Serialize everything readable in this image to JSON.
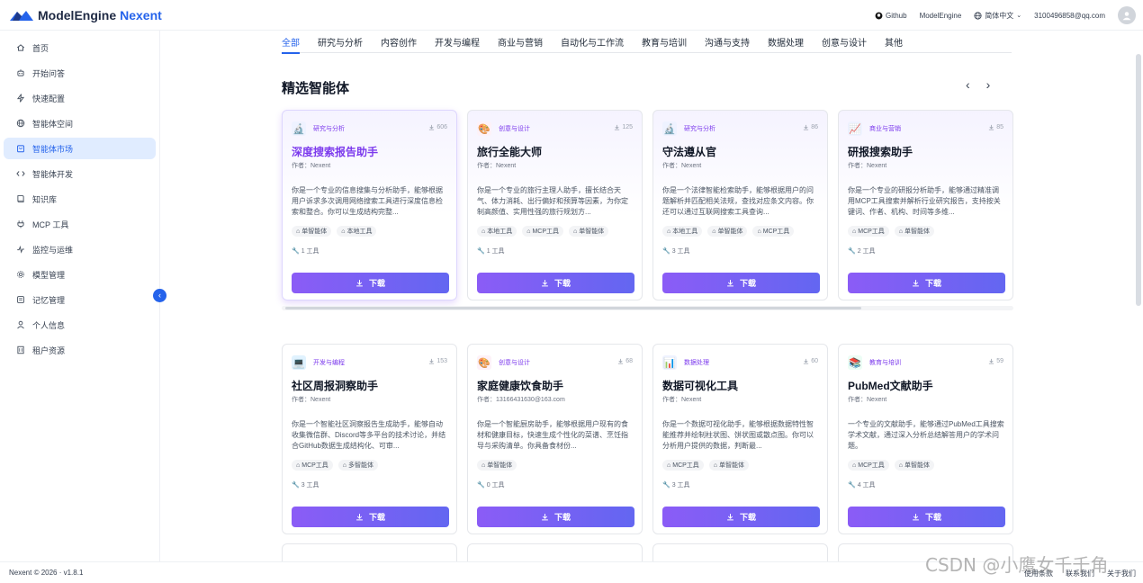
{
  "header": {
    "brand": "ModelEngine",
    "brand_accent": "Nexent",
    "github_label": "Github",
    "modelengine_label": "ModelEngine",
    "language_label": "简体中文",
    "user_email": "3100496858@qq.com"
  },
  "sidebar": {
    "items": [
      {
        "label": "首页",
        "icon": "home-icon"
      },
      {
        "label": "开始问答",
        "icon": "bot-icon"
      },
      {
        "label": "快速配置",
        "icon": "bolt-icon"
      },
      {
        "label": "智能体空间",
        "icon": "globe-icon"
      },
      {
        "label": "智能体市场",
        "icon": "store-icon",
        "active": true
      },
      {
        "label": "智能体开发",
        "icon": "code-icon"
      },
      {
        "label": "知识库",
        "icon": "book-icon"
      },
      {
        "label": "MCP 工具",
        "icon": "plug-icon"
      },
      {
        "label": "监控与运维",
        "icon": "monitor-icon"
      },
      {
        "label": "模型管理",
        "icon": "gear-icon"
      },
      {
        "label": "记忆管理",
        "icon": "memory-icon"
      },
      {
        "label": "个人信息",
        "icon": "user-icon"
      },
      {
        "label": "租户资源",
        "icon": "building-icon"
      }
    ]
  },
  "tabs": [
    "全部",
    "研究与分析",
    "内容创作",
    "开发与编程",
    "商业与营销",
    "自动化与工作流",
    "教育与培训",
    "沟通与支持",
    "数据处理",
    "创意与设计",
    "其他"
  ],
  "featured": {
    "title": "精选智能体",
    "prev_icon": "‹",
    "next_icon": "›"
  },
  "download_label": "下载",
  "featured_cards": [
    {
      "category": "研究与分析",
      "downloads": "606",
      "title": "深度搜索报告助手",
      "author": "作者：Nexent",
      "desc": "你是一个专业的信息搜集与分析助手，能够根据用户诉求多次调用网络搜索工具进行深度信息检索和整合。你可以生成结构完整...",
      "tags": [
        "单智能体",
        "本地工具"
      ],
      "tools": "1 工具",
      "icon": "🔬",
      "icon_bg": "#eef2ff"
    },
    {
      "category": "创意与设计",
      "downloads": "125",
      "title": "旅行全能大师",
      "author": "作者：Nexent",
      "desc": "你是一个专业的旅行主理人助手，擅长结合天气、体力消耗、出行偏好和预算等因素，为你定制高颜值、实用性强的旅行规划方...",
      "tags": [
        "本地工具",
        "MCP工具",
        "单智能体"
      ],
      "tools": "1 工具",
      "icon": "🎨",
      "icon_bg": "#fdf2f8"
    },
    {
      "category": "研究与分析",
      "downloads": "86",
      "title": "守法遵从官",
      "author": "作者：Nexent",
      "desc": "你是一个法律智能检索助手，能够根据用户的问题解析并匹配相关法规，查找对应条文内容。你还可以通过互联网搜索工具查询...",
      "tags": [
        "本地工具",
        "单智能体",
        "MCP工具"
      ],
      "tools": "3 工具",
      "icon": "🔬",
      "icon_bg": "#eef2ff"
    },
    {
      "category": "商业与营销",
      "downloads": "85",
      "title": "研报搜索助手",
      "author": "作者：Nexent",
      "desc": "你是一个专业的研报分析助手，能够通过精准调用MCP工具搜索并解析行业研究报告，支持按关键词、作者、机构、时间等多维...",
      "tags": [
        "MCP工具",
        "单智能体"
      ],
      "tools": "2 工具",
      "icon": "📈",
      "icon_bg": "#eef2ff"
    }
  ],
  "cards": [
    {
      "category": "开发与编程",
      "downloads": "153",
      "title": "社区周报洞察助手",
      "author": "作者：Nexent",
      "desc": "你是一个智能社区洞察报告生成助手，能够自动收集微信群、Discord等多平台的技术讨论，并结合GitHub数据生成结构化、可审...",
      "tags": [
        "MCP工具",
        "多智能体"
      ],
      "tools": "3 工具",
      "icon": "💻",
      "icon_bg": "#e0f2fe"
    },
    {
      "category": "创意与设计",
      "downloads": "68",
      "title": "家庭健康饮食助手",
      "author": "作者：13166431630@163.com",
      "desc": "你是一个智能厨房助手，能够根据用户现有的食材和健康目标，快速生成个性化的菜谱、烹饪指导与采购清单。你具备食材份...",
      "tags": [
        "单智能体"
      ],
      "tools": "0 工具",
      "icon": "🎨",
      "icon_bg": "#fdf2f8"
    },
    {
      "category": "数据处理",
      "downloads": "60",
      "title": "数据可视化工具",
      "author": "作者：Nexent",
      "desc": "你是一个数据可视化助手，能够根据数据特性智能推荐并绘制柱状图、饼状图或散点图。你可以分析用户提供的数据，判断最...",
      "tags": [
        "MCP工具",
        "单智能体"
      ],
      "tools": "3 工具",
      "icon": "📊",
      "icon_bg": "#eef2ff"
    },
    {
      "category": "教育与培训",
      "downloads": "59",
      "title": "PubMed文献助手",
      "author": "作者：Nexent",
      "desc": "一个专业的文献助手，能够通过PubMed工具搜索学术文献，通过深入分析总结解答用户的学术问题。",
      "tags": [
        "MCP工具",
        "单智能体"
      ],
      "tools": "4 工具",
      "icon": "📚",
      "icon_bg": "#ecfdf5"
    }
  ],
  "footer": {
    "version": "Nexent © 2026 · v1.8.1",
    "links": [
      "使用条款",
      "联系我们",
      "关于我们"
    ]
  },
  "watermark": "CSDN @小鹰女千千角"
}
